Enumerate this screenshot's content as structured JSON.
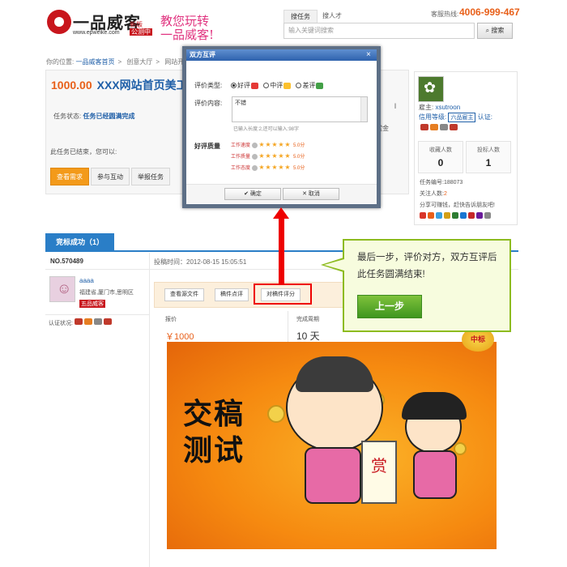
{
  "header": {
    "logo_text": "一品威客",
    "logo_url": "www.epweike.com",
    "logo_badge_top": "新版",
    "logo_badge_bottom": "公测中",
    "slogan_line1": "教您玩转",
    "slogan_line2": "一品威客!",
    "tabs": [
      {
        "label": "搜任务"
      },
      {
        "label": "搜人才"
      }
    ],
    "search_placeholder": "输入关键词搜索",
    "search_button": "搜索",
    "hotline_label": "客服热线:",
    "hotline": "4006-999-467"
  },
  "breadcrumb": {
    "prefix": "你的位置:",
    "items": [
      "一品威客首页",
      "创意大厅",
      "网站开发"
    ]
  },
  "task": {
    "price": "1000.00",
    "title": "XXX网站首页美工",
    "status_label": "任务状态:",
    "status_value": "任务已经圆满完成",
    "ended_text": "此任务已结束，您可以:",
    "tabs": [
      {
        "label": "查看需求",
        "active": true
      },
      {
        "label": "参与互动",
        "active": false
      },
      {
        "label": "举报任务",
        "active": false
      }
    ],
    "right_fragment_1": "l",
    "right_fragment_2": "赏金"
  },
  "sidebar": {
    "owner_label": "雇主:",
    "owner_name": "xsutroon",
    "credit_label": "信用等级:",
    "credit_level": "六品雇主",
    "verify_label": "认证:",
    "stats": [
      {
        "label": "收藏人数",
        "value": "0"
      },
      {
        "label": "投标人数",
        "value": "1"
      }
    ],
    "task_no_label": "任务编号:",
    "task_no": "188073",
    "follow_label": "关注人数:",
    "follow_count": "2",
    "share_text": "分享可赚钱，赶快告诉朋友吧!"
  },
  "bid": {
    "tab_label": "竞标成功（1）",
    "number": "NO.570489",
    "time": "投稿时间：2012-08-15 15:05:51",
    "user_name": "aaaa",
    "user_location": "福建省,厦门市,思明区",
    "user_level": "五品威客",
    "auth_label": "认证状况:",
    "actions": [
      {
        "label": "查看源文件"
      },
      {
        "label": "稿件点评"
      },
      {
        "label": "对稿件评分"
      }
    ],
    "price_label": "报价",
    "price_value": "￥1000",
    "cycle_label": "完成周期",
    "cycle_value": "10 天",
    "win_badge": "中标",
    "image_caption": "交稿测试",
    "scroll_text": "赏"
  },
  "dialog": {
    "title": "双方互评",
    "close": "×",
    "type_label": "评价类型:",
    "options": [
      {
        "label": "好评",
        "selected": true
      },
      {
        "label": "中评",
        "selected": false
      },
      {
        "label": "差评",
        "selected": false
      }
    ],
    "content_label": "评价内容:",
    "content_value": "不错",
    "hint": "已输入长度:2,还可以输入:98字",
    "rating_label": "好评质量",
    "ratings": [
      {
        "label": "工作速度",
        "score": "5.0分",
        "stars": 5
      },
      {
        "label": "工作质量",
        "score": "5.0分",
        "stars": 5
      },
      {
        "label": "工作态度",
        "score": "5.0分",
        "stars": 5
      }
    ],
    "confirm": "确定",
    "cancel": "取消"
  },
  "callout": {
    "text": "最后一步，评价对方，双方互评后此任务圆满结束!",
    "button": "上一步"
  },
  "colors": {
    "accent_orange": "#f39a1a",
    "link_blue": "#1f5fa8",
    "highlight_red": "#ee0000",
    "callout_green": "#8dbb1f"
  }
}
